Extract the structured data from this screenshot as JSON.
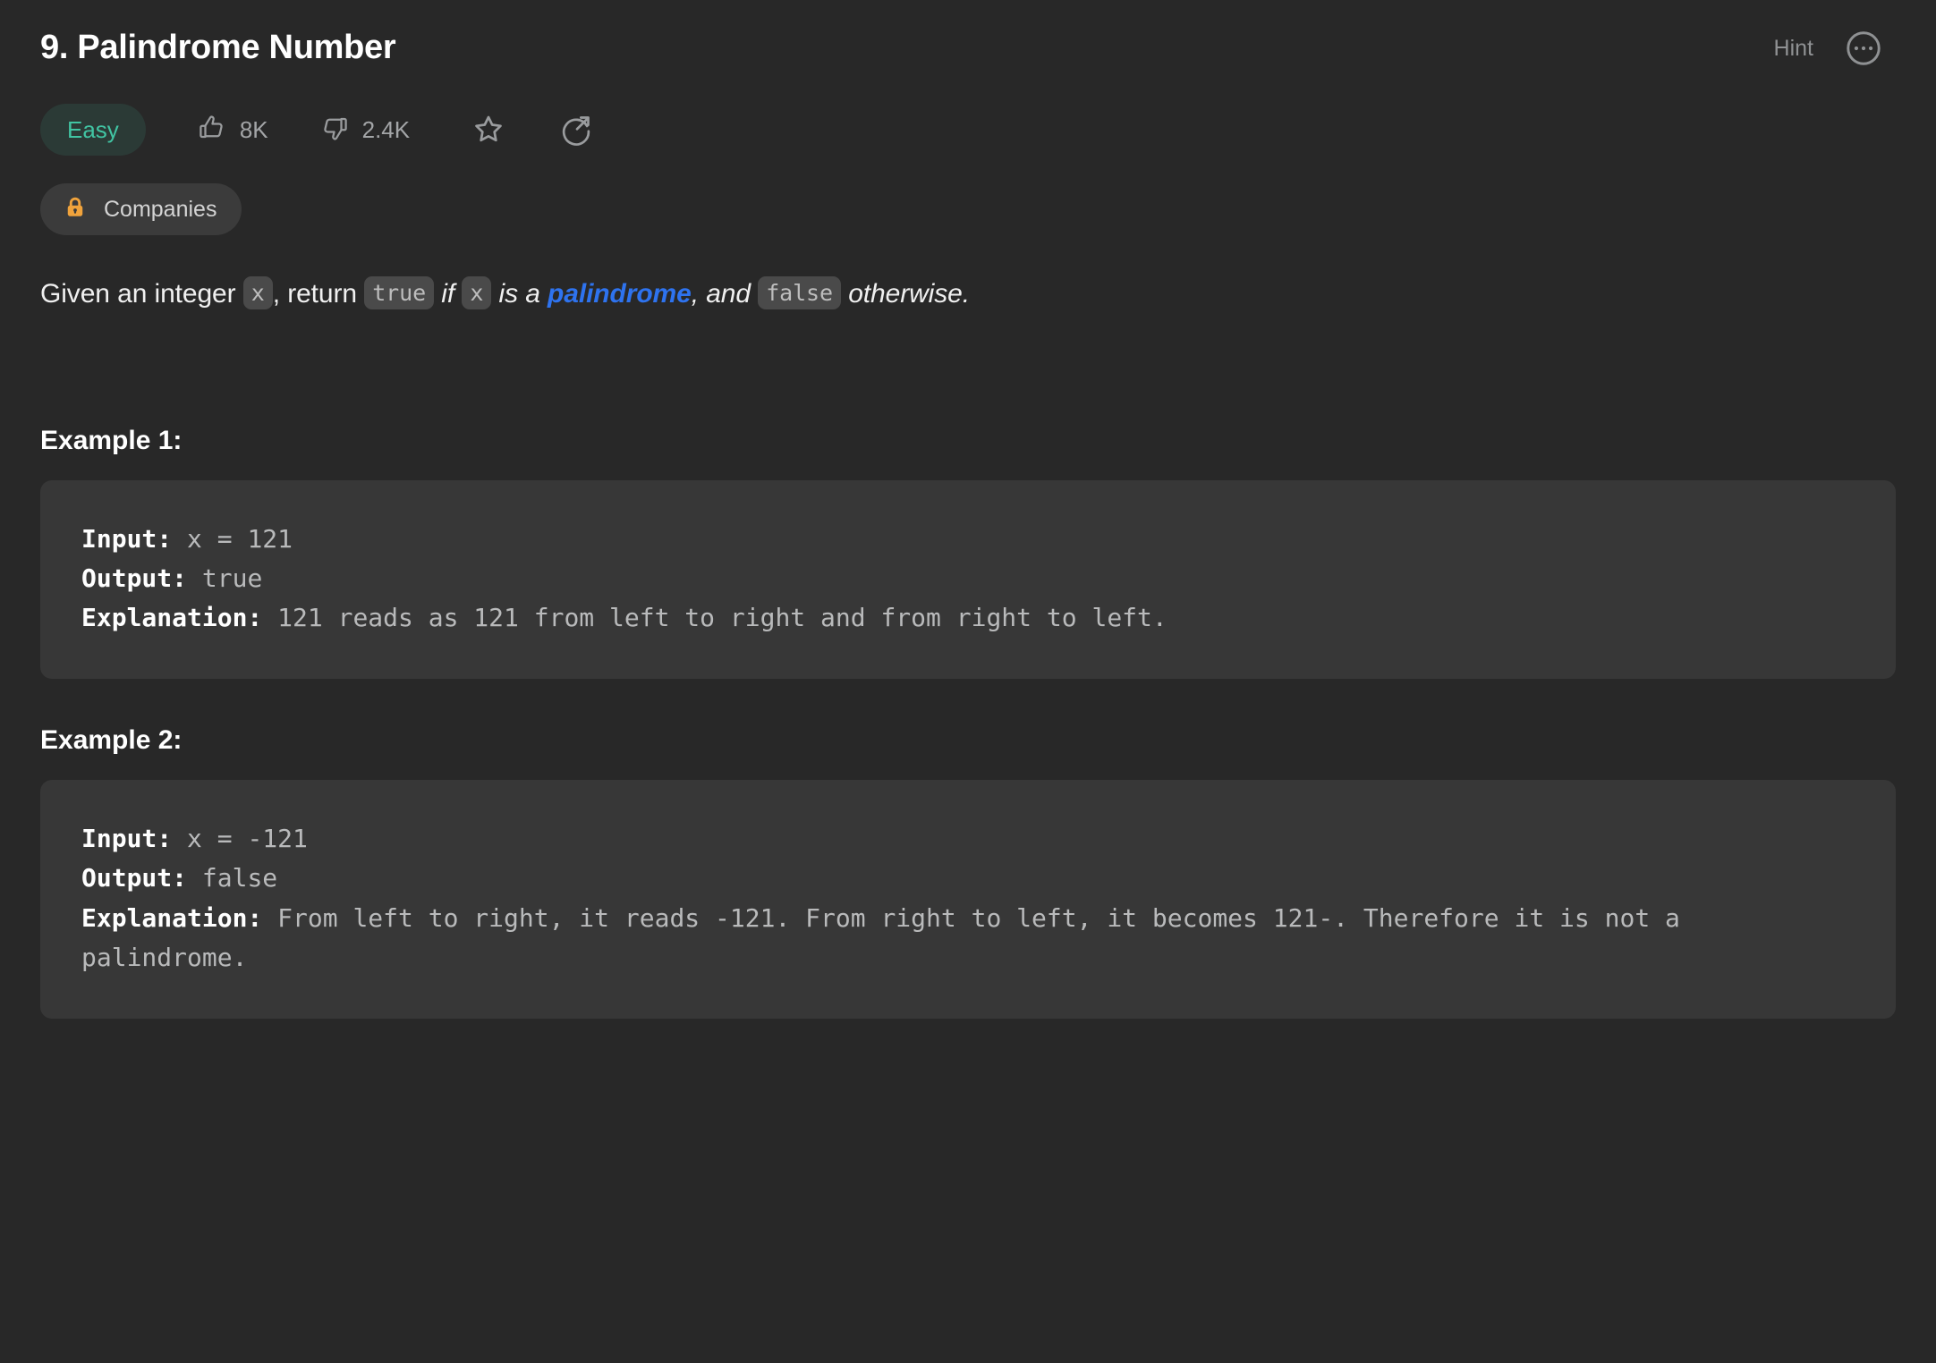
{
  "header": {
    "title": "9. Palindrome Number",
    "hint_label": "Hint",
    "more_icon": "ellipsis-circle-icon"
  },
  "meta": {
    "difficulty": "Easy",
    "difficulty_color": "#41c4a3",
    "upvotes": "8K",
    "downvotes": "2.4K",
    "thumbs_up_icon": "thumbs-up-icon",
    "thumbs_down_icon": "thumbs-down-icon",
    "favorite_icon": "star-icon",
    "share_icon": "share-circle-icon"
  },
  "companies": {
    "label": "Companies",
    "lock_icon": "lock-icon",
    "lock_color": "#f0a33c"
  },
  "description": {
    "part1": "Given an integer ",
    "code_x1": "x",
    "part2": ", return ",
    "code_true": "true",
    "part3": " if ",
    "code_x2": "x",
    "part4": " is a ",
    "link": "palindrome",
    "part5": ", and ",
    "code_false": "false",
    "part6": " otherwise.",
    "link_color": "#2e73ef"
  },
  "examples": [
    {
      "heading": "Example 1:",
      "input_key": "Input:",
      "input_value": " x = 121",
      "output_key": "Output:",
      "output_value": " true",
      "explanation_key": "Explanation:",
      "explanation_value": " 121 reads as 121 from left to right and from right to left."
    },
    {
      "heading": "Example 2:",
      "input_key": "Input:",
      "input_value": " x = -121",
      "output_key": "Output:",
      "output_value": " false",
      "explanation_key": "Explanation:",
      "explanation_value": " From left to right, it reads -121. From right to left, it becomes 121-. Therefore it is not a palindrome."
    }
  ],
  "colors": {
    "page_background": "#282828",
    "code_background": "#373737",
    "chip_background": "#3b3b3b"
  }
}
